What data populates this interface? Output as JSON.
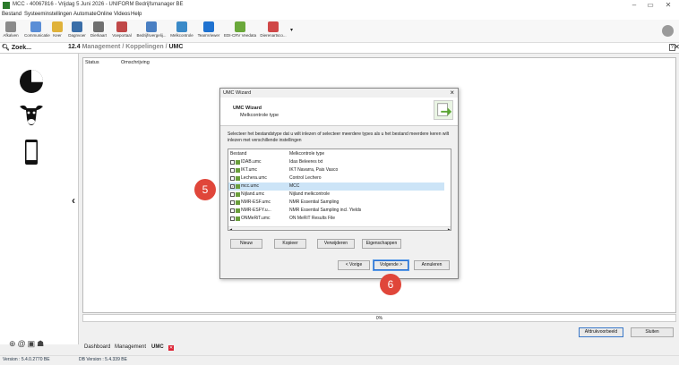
{
  "window": {
    "title": "MCC - 40067816 - Vrijdag 5 Juni 2026 - UNIFORM Bedrijfsmanager BE"
  },
  "menu": [
    "Bestand",
    "Systeeminstellingen",
    "Automate",
    "Online",
    "Videos",
    "Help"
  ],
  "toolbar": [
    {
      "label": "Afkalven",
      "icon": "barn-icon",
      "color": "#8a8a8a"
    },
    {
      "label": "Communicatie",
      "icon": "person-icon",
      "color": "#5a8ed6"
    },
    {
      "label": "Keer",
      "icon": "key-icon",
      "color": "#e0b23a"
    },
    {
      "label": "Dagnvoer",
      "icon": "feed-icon",
      "color": "#3a6ea8"
    },
    {
      "label": "Dierkaart",
      "icon": "cow-card-icon",
      "color": "#6f6f6f"
    },
    {
      "label": "Voeportaal",
      "icon": "syringe-icon",
      "color": "#c04848"
    },
    {
      "label": "Bedrijfsvergelij...",
      "icon": "compare-icon",
      "color": "#4a7fc2"
    },
    {
      "label": "Melkcontrole",
      "icon": "milk-icon",
      "color": "#3a8ac8"
    },
    {
      "label": "TeamViewer",
      "icon": "teamviewer-icon",
      "color": "#1f72d0"
    },
    {
      "label": "EDI-CRV Veedata",
      "icon": "edi-icon",
      "color": "#6aa83a"
    },
    {
      "label": "Dierenartsco...",
      "icon": "vet-icon",
      "color": "#d04848"
    }
  ],
  "search": {
    "label": "Zoek..."
  },
  "breadcrumb": {
    "number": "12.4",
    "part1": "Management",
    "sep": "/",
    "part2": "Koppelingen",
    "part3": "UMC"
  },
  "help_label": "?",
  "main": {
    "col_status": "Status",
    "col_desc": "Omschrijving"
  },
  "progress": {
    "text": "0%",
    "value": 0
  },
  "buttons": {
    "preview": "Afdrukvoorbeeld",
    "close": "Sluiten"
  },
  "tabs": [
    "Dashboard",
    "Management",
    "UMC"
  ],
  "status": {
    "version": "Version : 5.4.0.2770 BE",
    "db_version": "DB Version : 5.4.339 BE"
  },
  "dialog": {
    "title": "UMC Wizard",
    "close": "×",
    "heading": "UMC Wizard",
    "subheading": "Melkcontrole type",
    "instructions": "Selecteer het bestandstype dat u wilt inlezen of selecteer meerdere types als u het bestand meerdere keren wilt inlezen met verschillende instellingen",
    "list_headers": {
      "file": "Bestand",
      "type": "Melkcontrole type"
    },
    "rows": [
      {
        "file": "IDAB.umc",
        "type": "Idas Beleeres txt",
        "selected": false,
        "checked": false
      },
      {
        "file": "IKT.umc",
        "type": "IKT Navarra, Pais Vasco",
        "selected": false,
        "checked": false
      },
      {
        "file": "Lechera.umc",
        "type": "Control Lechero",
        "selected": false,
        "checked": false
      },
      {
        "file": "mcc.umc",
        "type": "MCC",
        "selected": true,
        "checked": true
      },
      {
        "file": "Nijland.umc",
        "type": "Nijland melkcontrole",
        "selected": false,
        "checked": false
      },
      {
        "file": "NMR-ESF.umc",
        "type": "NMR Essential Sampling",
        "selected": false,
        "checked": false
      },
      {
        "file": "NMR-ESFY.u...",
        "type": "NMR Essential Sampling incl. Yields",
        "selected": false,
        "checked": false
      },
      {
        "file": "ONMeRiT.umc",
        "type": "ON MeRiT Results File",
        "selected": false,
        "checked": false
      }
    ],
    "actions": {
      "new": "Nieuw",
      "copy": "Kopieer",
      "delete": "Verwijderen",
      "props": "Eigenschappen"
    },
    "nav": {
      "back": "< Vorige",
      "next": "Volgende >",
      "cancel": "Annuleren"
    }
  },
  "markers": [
    "5",
    "6"
  ]
}
